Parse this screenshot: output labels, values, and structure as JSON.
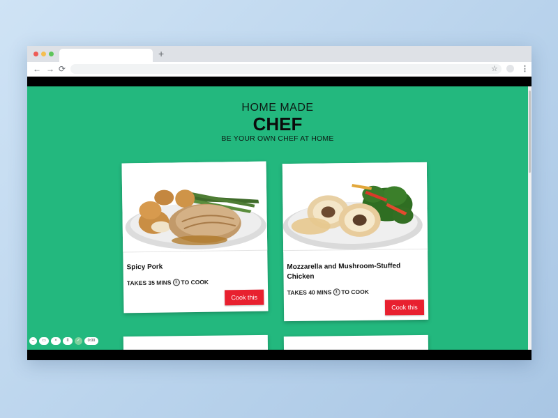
{
  "browser": {
    "tab_title": "",
    "new_tab": "+",
    "back": "←",
    "forward": "→",
    "reload": "⟳",
    "bookmark": "☆",
    "menu": "⋮"
  },
  "hero": {
    "pre_title": "HOME MADE",
    "title": "CHEF",
    "subtitle": "BE YOUR OWN CHEF AT HOME"
  },
  "recipes": [
    {
      "name": "Spicy Pork",
      "time_prefix": "TAKES 35 MINS",
      "time_suffix": "TO COOK",
      "button": "Cook this"
    },
    {
      "name": "Mozzarella and Mushroom-Stuffed Chicken",
      "time_prefix": "TAKES 40 MINS",
      "time_suffix": "TO COOK",
      "button": "Cook this"
    }
  ],
  "player_controls": {
    "minus": "–",
    "camera": "▭",
    "close": "×",
    "pause": "II",
    "check": "✓",
    "time": "0:00"
  },
  "colors": {
    "background": "#23b87e",
    "button": "#e8202f"
  }
}
